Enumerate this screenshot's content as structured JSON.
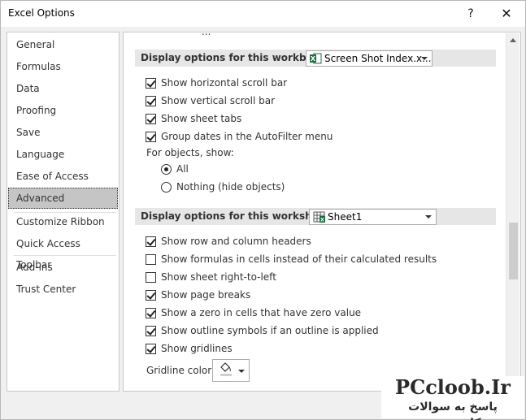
{
  "window": {
    "title": "Excel Options",
    "help_glyph": "?",
    "close_glyph": "✕"
  },
  "nav": {
    "items": [
      {
        "label": "General"
      },
      {
        "label": "Formulas"
      },
      {
        "label": "Data"
      },
      {
        "label": "Proofing"
      },
      {
        "label": "Save"
      },
      {
        "label": "Language"
      },
      {
        "label": "Ease of Access"
      },
      {
        "label": "Advanced",
        "selected": true
      },
      {
        "label": "Customize Ribbon"
      },
      {
        "label": "Quick Access Toolbar"
      },
      {
        "label": "Add-ins"
      },
      {
        "label": "Trust Center"
      }
    ]
  },
  "content": {
    "cut_heading": "...",
    "workbook_section": {
      "label": "Display options for this workbook:",
      "dropdown_value": "Screen Shot Index.x..."
    },
    "workbook_options": [
      {
        "label": "Show horizontal scroll bar",
        "checked": true
      },
      {
        "label": "Show vertical scroll bar",
        "checked": true
      },
      {
        "label": "Show sheet tabs",
        "checked": true
      },
      {
        "label": "Group dates in the AutoFilter menu",
        "checked": true
      }
    ],
    "objects_label": "For objects, show:",
    "objects_options": [
      {
        "label": "All",
        "selected": true
      },
      {
        "label": "Nothing (hide objects)",
        "selected": false
      }
    ],
    "worksheet_section": {
      "label": "Display options for this worksheet:",
      "dropdown_value": "Sheet1"
    },
    "worksheet_options": [
      {
        "label": "Show row and column headers",
        "checked": true
      },
      {
        "label": "Show formulas in cells instead of their calculated results",
        "checked": false
      },
      {
        "label": "Show sheet right-to-left",
        "checked": false
      },
      {
        "label": "Show page breaks",
        "checked": true
      },
      {
        "label": "Show a zero in cells that have zero value",
        "checked": true
      },
      {
        "label": "Show outline symbols if an outline is applied",
        "checked": true
      },
      {
        "label": "Show gridlines",
        "checked": true
      }
    ],
    "gridline_color_label": "Gridline color"
  },
  "watermark": {
    "line1": "PCcloob.Ir",
    "line2": "پاسخ به سوالات کامپیوتری"
  },
  "colors": {
    "selected_nav": "#c5c5c5",
    "section_bg": "#e6e6e6",
    "excel_green": "#1d6f42"
  }
}
